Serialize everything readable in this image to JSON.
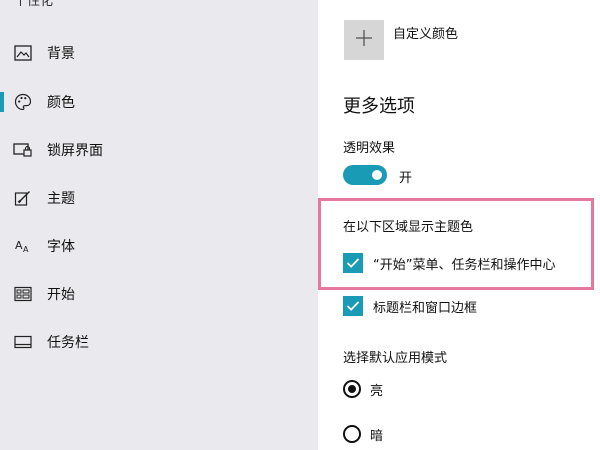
{
  "sidebar": {
    "top_label": "个性化",
    "items": [
      {
        "label": "背景",
        "icon": "image-icon"
      },
      {
        "label": "颜色",
        "icon": "palette-icon",
        "active": true
      },
      {
        "label": "锁屏界面",
        "icon": "lock-screen-icon"
      },
      {
        "label": "主题",
        "icon": "theme-brush-icon"
      },
      {
        "label": "字体",
        "icon": "font-icon"
      },
      {
        "label": "开始",
        "icon": "start-menu-icon"
      },
      {
        "label": "任务栏",
        "icon": "taskbar-icon"
      }
    ]
  },
  "main": {
    "custom_color_label": "自定义颜色",
    "more_options_title": "更多选项",
    "transparency_label": "透明效果",
    "transparency_state": "开",
    "accent_surfaces_label": "在以下区域显示主题色",
    "checkbox_start_label": "“开始”菜单、任务栏和操作中心",
    "checkbox_titlebar_label": "标题栏和窗口边框",
    "app_mode_label": "选择默认应用模式",
    "mode_light_label": "亮",
    "mode_dark_label": "暗"
  },
  "colors": {
    "accent": "#1a9bb5",
    "sidebar_bg": "#e9e9ee",
    "highlight_border": "#e6779f"
  }
}
